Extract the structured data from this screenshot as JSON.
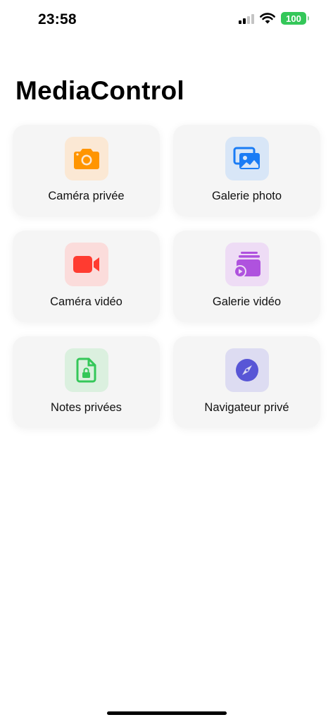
{
  "status_bar": {
    "time": "23:58",
    "battery": "100",
    "icons": [
      "cellular-signal-icon",
      "wifi-icon",
      "battery-icon"
    ]
  },
  "app": {
    "title": "MediaControl"
  },
  "tiles": [
    {
      "label": "Caméra privée",
      "icon": "camera-icon",
      "color": "#ff9500",
      "bg": "#fbe8d4"
    },
    {
      "label": "Galerie photo",
      "icon": "photo-gallery-icon",
      "color": "#1a7cf5",
      "bg": "#d8e6f7"
    },
    {
      "label": "Caméra vidéo",
      "icon": "video-camera-icon",
      "color": "#ff3b30",
      "bg": "#fbdcdb"
    },
    {
      "label": "Galerie vidéo",
      "icon": "video-gallery-icon",
      "color": "#af52de",
      "bg": "#eedcf5"
    },
    {
      "label": "Notes privées",
      "icon": "locked-document-icon",
      "color": "#34c759",
      "bg": "#dbf0df"
    },
    {
      "label": "Navigateur privé",
      "icon": "compass-icon",
      "color": "#5856d6",
      "bg": "#dddcf2"
    }
  ]
}
